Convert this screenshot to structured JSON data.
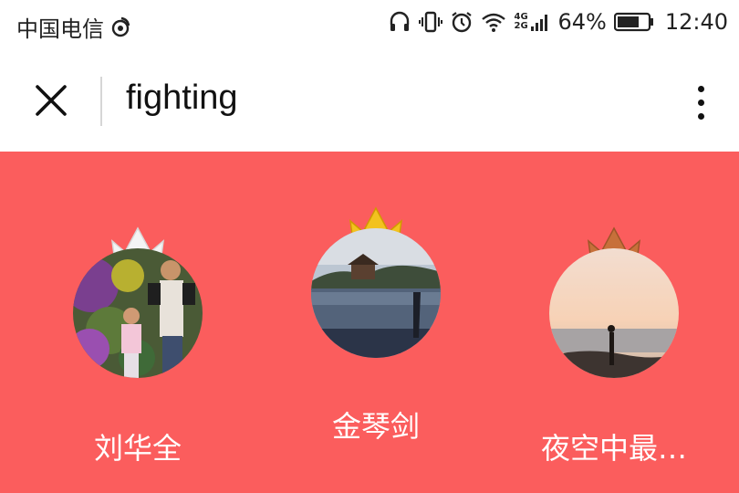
{
  "status_bar": {
    "carrier": "中国电信",
    "battery_percent": "64%",
    "time": "12:40",
    "network_label": "4G 2G",
    "icons": [
      "weibo-icon",
      "headphones-icon",
      "vibrate-icon",
      "alarm-icon",
      "wifi-icon",
      "signal-icon",
      "battery-icon"
    ]
  },
  "header": {
    "title": "fighting"
  },
  "ranking": {
    "background": "#fb5d5d",
    "entries": [
      {
        "rank": "2",
        "name": "刘华全",
        "crown_color": "#f4f4f4"
      },
      {
        "rank": "1",
        "name": "金琴剑",
        "crown_color": "#f2c21f"
      },
      {
        "rank": "3",
        "name": "夜空中最…",
        "crown_color": "#c7703a"
      }
    ]
  }
}
